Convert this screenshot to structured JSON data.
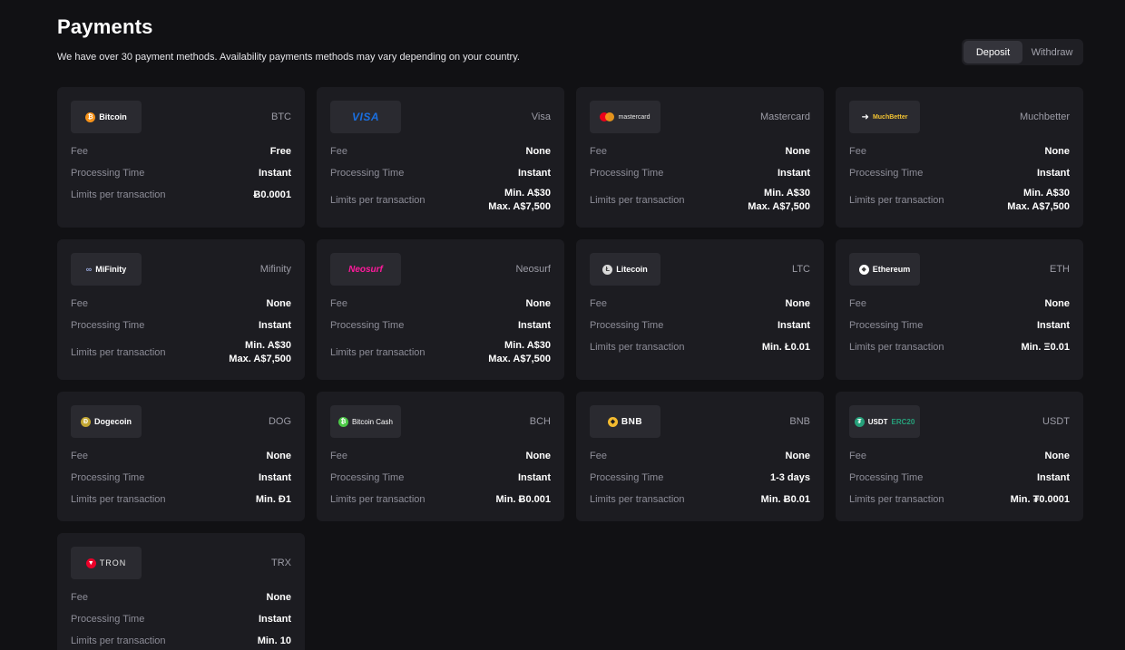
{
  "header": {
    "title": "Payments",
    "subtitle": "We have over 30 payment methods. Availability payments methods may vary depending on your country."
  },
  "toggle": {
    "deposit_label": "Deposit",
    "withdraw_label": "Withdraw",
    "active": "Deposit"
  },
  "labels": {
    "fee": "Fee",
    "processing": "Processing Time",
    "limits": "Limits per transaction"
  },
  "colors": {
    "background": "#111114",
    "card": "#1c1c21",
    "accent_btc": "#f7931a"
  },
  "methods": [
    {
      "logo_text": "Bitcoin",
      "icon": "bitcoin-icon",
      "code": "BTC",
      "fee": "Free",
      "processing": "Instant",
      "limits": [
        "Ƀ0.0001"
      ]
    },
    {
      "logo_text": "VISA",
      "icon": "visa-logo",
      "code": "Visa",
      "fee": "None",
      "processing": "Instant",
      "limits": [
        "Min. A$30",
        "Max. A$7,500"
      ]
    },
    {
      "logo_text": "mastercard",
      "icon": "mastercard-logo",
      "code": "Mastercard",
      "fee": "None",
      "processing": "Instant",
      "limits": [
        "Min. A$30",
        "Max. A$7,500"
      ]
    },
    {
      "logo_text": "MuchBetter",
      "icon": "muchbetter-logo",
      "code": "Muchbetter",
      "fee": "None",
      "processing": "Instant",
      "limits": [
        "Min. A$30",
        "Max. A$7,500"
      ]
    },
    {
      "logo_text": "MiFinity",
      "icon": "mifinity-logo",
      "code": "Mifinity",
      "fee": "None",
      "processing": "Instant",
      "limits": [
        "Min. A$30",
        "Max. A$7,500"
      ]
    },
    {
      "logo_text": "Neosurf",
      "icon": "neosurf-logo",
      "code": "Neosurf",
      "fee": "None",
      "processing": "Instant",
      "limits": [
        "Min. A$30",
        "Max. A$7,500"
      ]
    },
    {
      "logo_text": "Litecoin",
      "icon": "litecoin-icon",
      "code": "LTC",
      "fee": "None",
      "processing": "Instant",
      "limits": [
        "Min. Ł0.01"
      ]
    },
    {
      "logo_text": "Ethereum",
      "icon": "ethereum-icon",
      "code": "ETH",
      "fee": "None",
      "processing": "Instant",
      "limits": [
        "Min. Ξ0.01"
      ]
    },
    {
      "logo_text": "Dogecoin",
      "icon": "dogecoin-icon",
      "code": "DOG",
      "fee": "None",
      "processing": "Instant",
      "limits": [
        "Min. Ð1"
      ]
    },
    {
      "logo_text": "Bitcoin Cash",
      "icon": "bitcoin-cash-icon",
      "code": "BCH",
      "fee": "None",
      "processing": "Instant",
      "limits": [
        "Min. Ƀ0.001"
      ]
    },
    {
      "logo_text": "BNB",
      "icon": "bnb-icon",
      "code": "BNB",
      "fee": "None",
      "processing": "1-3 days",
      "limits": [
        "Min. Ƀ0.01"
      ]
    },
    {
      "logo_text": "USDT",
      "logo_text_2": "ERC20",
      "icon": "tether-icon",
      "code": "USDT",
      "fee": "None",
      "processing": "Instant",
      "limits": [
        "Min. ₮0.0001"
      ]
    },
    {
      "logo_text": "TRON",
      "icon": "tron-icon",
      "code": "TRX",
      "fee": "None",
      "processing": "Instant",
      "limits": [
        "Min. 10"
      ]
    }
  ]
}
